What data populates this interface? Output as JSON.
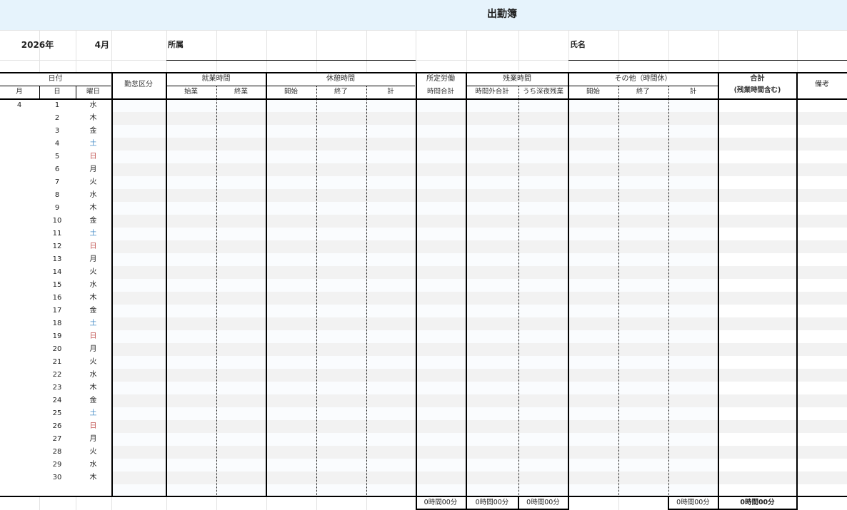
{
  "title": "出勤簿",
  "info": {
    "year": "2026年",
    "month": "4月",
    "affiliation_label": "所属",
    "name_label": "氏名"
  },
  "headers": {
    "date": "日付",
    "month": "月",
    "day": "日",
    "weekday": "曜日",
    "attendance_type": "勤怠区分",
    "work_time": "就業時間",
    "work_start": "始業",
    "work_end": "終業",
    "break_time": "休憩時間",
    "break_start": "開始",
    "break_end": "終了",
    "break_total": "計",
    "scheduled_line1": "所定労働",
    "scheduled_line2": "時間合計",
    "overtime": "残業時間",
    "overtime_outside": "時間外合計",
    "overtime_night": "うち深夜残業",
    "other": "その他（時間休）",
    "other_start": "開始",
    "other_end": "終了",
    "other_total": "計",
    "total_line1": "合計",
    "total_line2": "(残業時間含む)",
    "notes": "備考"
  },
  "rows": [
    {
      "month": "4",
      "day": "1",
      "weekday": "水",
      "type": "weekday"
    },
    {
      "month": "",
      "day": "2",
      "weekday": "木",
      "type": "weekday"
    },
    {
      "month": "",
      "day": "3",
      "weekday": "金",
      "type": "weekday"
    },
    {
      "month": "",
      "day": "4",
      "weekday": "土",
      "type": "saturday"
    },
    {
      "month": "",
      "day": "5",
      "weekday": "日",
      "type": "sunday"
    },
    {
      "month": "",
      "day": "6",
      "weekday": "月",
      "type": "weekday"
    },
    {
      "month": "",
      "day": "7",
      "weekday": "火",
      "type": "weekday"
    },
    {
      "month": "",
      "day": "8",
      "weekday": "水",
      "type": "weekday"
    },
    {
      "month": "",
      "day": "9",
      "weekday": "木",
      "type": "weekday"
    },
    {
      "month": "",
      "day": "10",
      "weekday": "金",
      "type": "weekday"
    },
    {
      "month": "",
      "day": "11",
      "weekday": "土",
      "type": "saturday"
    },
    {
      "month": "",
      "day": "12",
      "weekday": "日",
      "type": "sunday"
    },
    {
      "month": "",
      "day": "13",
      "weekday": "月",
      "type": "weekday"
    },
    {
      "month": "",
      "day": "14",
      "weekday": "火",
      "type": "weekday"
    },
    {
      "month": "",
      "day": "15",
      "weekday": "水",
      "type": "weekday"
    },
    {
      "month": "",
      "day": "16",
      "weekday": "木",
      "type": "weekday"
    },
    {
      "month": "",
      "day": "17",
      "weekday": "金",
      "type": "weekday"
    },
    {
      "month": "",
      "day": "18",
      "weekday": "土",
      "type": "saturday"
    },
    {
      "month": "",
      "day": "19",
      "weekday": "日",
      "type": "sunday"
    },
    {
      "month": "",
      "day": "20",
      "weekday": "月",
      "type": "weekday"
    },
    {
      "month": "",
      "day": "21",
      "weekday": "火",
      "type": "weekday"
    },
    {
      "month": "",
      "day": "22",
      "weekday": "水",
      "type": "weekday"
    },
    {
      "month": "",
      "day": "23",
      "weekday": "木",
      "type": "weekday"
    },
    {
      "month": "",
      "day": "24",
      "weekday": "金",
      "type": "weekday"
    },
    {
      "month": "",
      "day": "25",
      "weekday": "土",
      "type": "saturday"
    },
    {
      "month": "",
      "day": "26",
      "weekday": "日",
      "type": "sunday"
    },
    {
      "month": "",
      "day": "27",
      "weekday": "月",
      "type": "weekday"
    },
    {
      "month": "",
      "day": "28",
      "weekday": "火",
      "type": "weekday"
    },
    {
      "month": "",
      "day": "29",
      "weekday": "水",
      "type": "weekday"
    },
    {
      "month": "",
      "day": "30",
      "weekday": "木",
      "type": "weekday"
    },
    {
      "month": "",
      "day": "",
      "weekday": "",
      "type": "weekday"
    }
  ],
  "totals": {
    "scheduled": "0時間00分",
    "overtime_outside": "0時間00分",
    "overtime_night": "0時間00分",
    "other": "0時間00分",
    "grand": "0時間00分"
  },
  "colors": {
    "title_band": "#e6f3fc",
    "row_stripe": "#f2f2f2",
    "row_light": "#fafcfe",
    "saturday": "#4a8fc8",
    "sunday": "#c0504d",
    "gridline": "#e2e2e2"
  }
}
